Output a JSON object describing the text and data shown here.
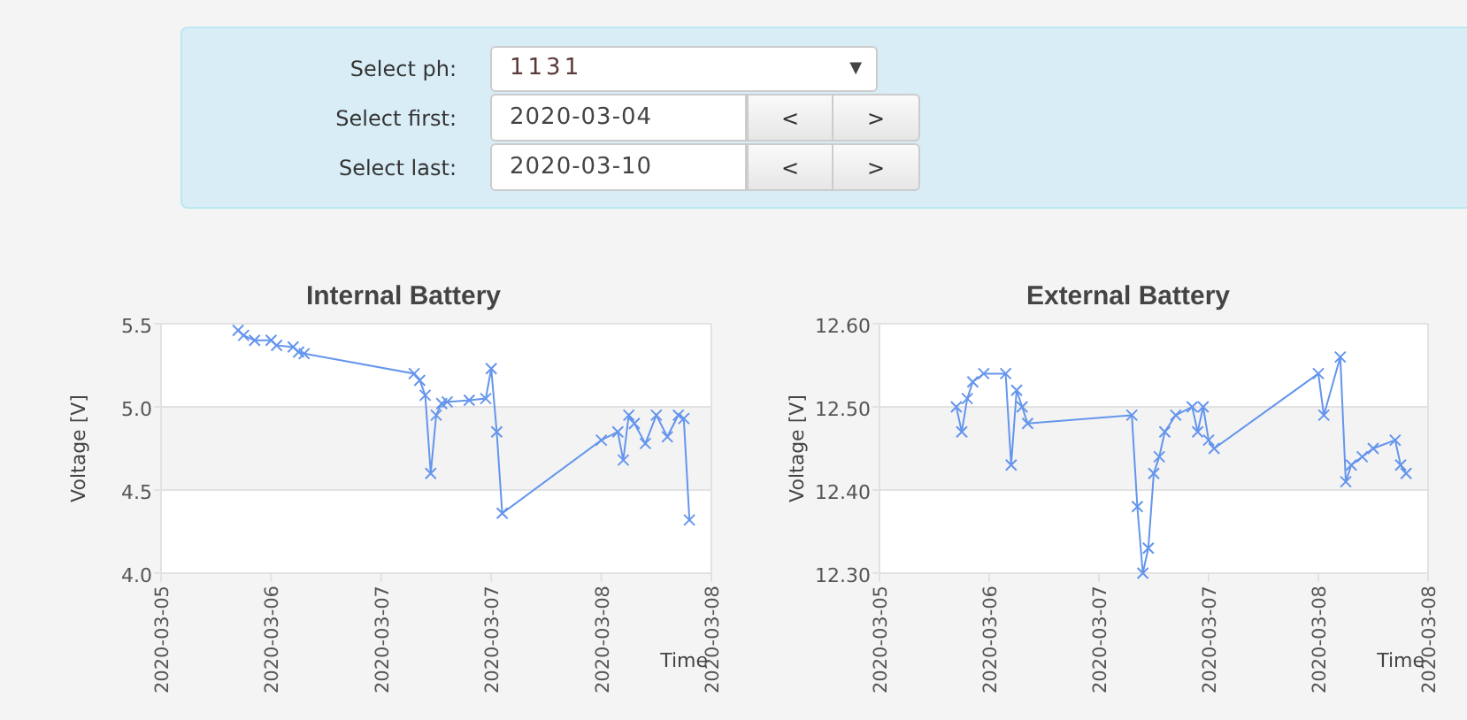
{
  "form": {
    "ph": {
      "label": "Select ph:",
      "value": "1131",
      "caret": "▼"
    },
    "dates": [
      {
        "label": "Select first:",
        "value": "2020-03-04",
        "prev": "<",
        "next": ">"
      },
      {
        "label": "Select last:",
        "value": "2020-03-10",
        "prev": "<",
        "next": ">"
      }
    ]
  },
  "charts": [
    {
      "chart_data": {
        "type": "line",
        "title": "Internal Battery",
        "xlabel": "Time",
        "ylabel": "Voltage [V]",
        "ylim": [
          4.0,
          5.5
        ],
        "bands": [
          {
            "axis": "y",
            "from": 4.5,
            "to": 5.0,
            "color": "#f3f3f3"
          }
        ],
        "yticks": [
          {
            "value": 4.0,
            "label": "4.0"
          },
          {
            "value": 4.5,
            "label": "4.5"
          },
          {
            "value": 5.0,
            "label": "5.0"
          },
          {
            "value": 5.5,
            "label": "5.5"
          }
        ],
        "categories": [
          "2020-03-05",
          null,
          null,
          null,
          null,
          null,
          null,
          null,
          null,
          null,
          null,
          null,
          null,
          null,
          null,
          null,
          null,
          null,
          null,
          null,
          "2020-03-06",
          null,
          null,
          null,
          null,
          null,
          null,
          null,
          null,
          null,
          null,
          null,
          null,
          null,
          null,
          null,
          null,
          null,
          null,
          null,
          "2020-03-07",
          null,
          null,
          null,
          null,
          null,
          null,
          null,
          null,
          null,
          null,
          null,
          null,
          null,
          null,
          null,
          null,
          null,
          null,
          null,
          "2020-03-07",
          null,
          null,
          null,
          null,
          null,
          null,
          null,
          null,
          null,
          null,
          null,
          null,
          null,
          null,
          null,
          null,
          null,
          null,
          null,
          "2020-03-08",
          null,
          null,
          null,
          null,
          null,
          null,
          null,
          null,
          null,
          null,
          null,
          null,
          null,
          null,
          null,
          null,
          null,
          null,
          null,
          "2020-03-08"
        ],
        "series": [
          {
            "color": "#6495ed",
            "marker": "x",
            "values": [
              null,
              null,
              null,
              null,
              null,
              null,
              null,
              null,
              null,
              null,
              null,
              null,
              null,
              null,
              5.46,
              5.43,
              null,
              5.4,
              null,
              null,
              5.4,
              5.37,
              null,
              null,
              5.36,
              5.33,
              5.32,
              null,
              null,
              null,
              null,
              null,
              null,
              null,
              null,
              null,
              null,
              null,
              null,
              null,
              null,
              null,
              null,
              null,
              null,
              null,
              5.2,
              5.16,
              5.07,
              4.6,
              4.95,
              5.02,
              5.03,
              null,
              null,
              null,
              5.04,
              null,
              null,
              5.05,
              5.23,
              4.85,
              4.36,
              null,
              null,
              null,
              null,
              null,
              null,
              null,
              null,
              null,
              null,
              null,
              null,
              null,
              null,
              null,
              null,
              null,
              4.8,
              null,
              null,
              4.85,
              4.68,
              4.95,
              4.9,
              null,
              4.78,
              null,
              4.95,
              null,
              4.82,
              null,
              4.95,
              4.93,
              4.32,
              null,
              null,
              null,
              null
            ]
          }
        ]
      }
    },
    {
      "chart_data": {
        "type": "line",
        "title": "External Battery",
        "xlabel": "Time",
        "ylabel": "Voltage [V]",
        "ylim": [
          12.3,
          12.6
        ],
        "bands": [
          {
            "axis": "y",
            "from": 12.4,
            "to": 12.5,
            "color": "#f3f3f3"
          }
        ],
        "yticks": [
          {
            "value": 12.3,
            "label": "12.30"
          },
          {
            "value": 12.4,
            "label": "12.40"
          },
          {
            "value": 12.5,
            "label": "12.50"
          },
          {
            "value": 12.6,
            "label": "12.60"
          }
        ],
        "categories": [
          "2020-03-05",
          null,
          null,
          null,
          null,
          null,
          null,
          null,
          null,
          null,
          null,
          null,
          null,
          null,
          null,
          null,
          null,
          null,
          null,
          null,
          "2020-03-06",
          null,
          null,
          null,
          null,
          null,
          null,
          null,
          null,
          null,
          null,
          null,
          null,
          null,
          null,
          null,
          null,
          null,
          null,
          null,
          "2020-03-07",
          null,
          null,
          null,
          null,
          null,
          null,
          null,
          null,
          null,
          null,
          null,
          null,
          null,
          null,
          null,
          null,
          null,
          null,
          null,
          "2020-03-07",
          null,
          null,
          null,
          null,
          null,
          null,
          null,
          null,
          null,
          null,
          null,
          null,
          null,
          null,
          null,
          null,
          null,
          null,
          null,
          "2020-03-08",
          null,
          null,
          null,
          null,
          null,
          null,
          null,
          null,
          null,
          null,
          null,
          null,
          null,
          null,
          null,
          null,
          null,
          null,
          null,
          "2020-03-08"
        ],
        "series": [
          {
            "color": "#6495ed",
            "marker": "x",
            "values": [
              null,
              null,
              null,
              null,
              null,
              null,
              null,
              null,
              null,
              null,
              null,
              null,
              null,
              null,
              12.5,
              12.47,
              12.51,
              12.53,
              null,
              12.54,
              null,
              null,
              null,
              12.54,
              12.43,
              12.52,
              12.5,
              12.48,
              null,
              null,
              null,
              null,
              null,
              null,
              null,
              null,
              null,
              null,
              null,
              null,
              null,
              null,
              null,
              null,
              null,
              null,
              12.49,
              12.38,
              12.3,
              12.33,
              12.42,
              12.44,
              12.47,
              null,
              12.49,
              null,
              null,
              12.5,
              12.47,
              12.5,
              12.46,
              12.45,
              null,
              null,
              null,
              null,
              null,
              null,
              null,
              null,
              null,
              null,
              null,
              null,
              null,
              null,
              null,
              null,
              null,
              null,
              12.54,
              12.49,
              null,
              null,
              12.56,
              12.41,
              12.43,
              null,
              12.44,
              null,
              12.45,
              null,
              null,
              null,
              12.46,
              12.43,
              12.42,
              null,
              null,
              null,
              null
            ]
          }
        ]
      }
    }
  ]
}
